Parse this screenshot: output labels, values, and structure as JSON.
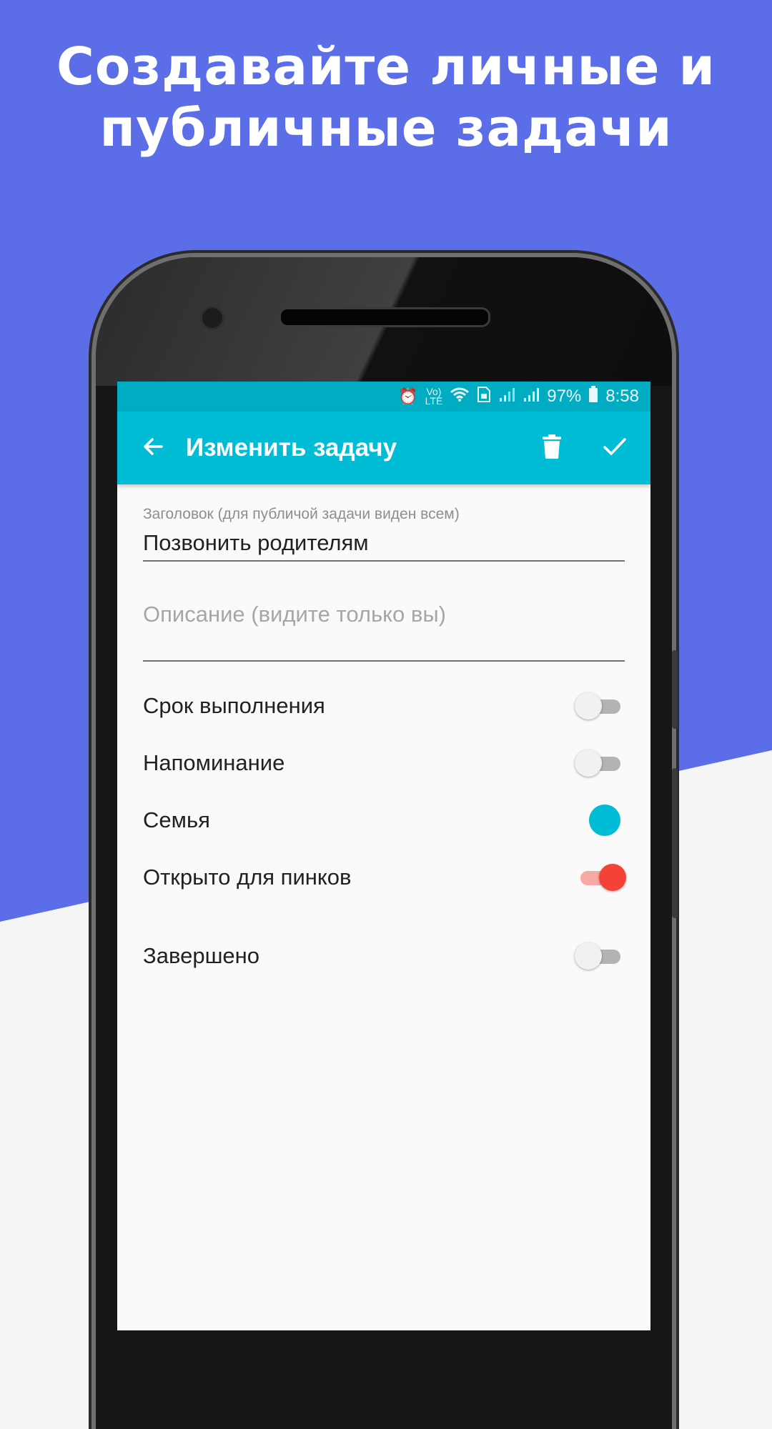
{
  "promo": {
    "line1": "Создавайте личные и",
    "line2": "публичные задачи"
  },
  "status_bar": {
    "icons": [
      "alarm-icon",
      "volte-lte-icon",
      "wifi-icon",
      "sim-icon",
      "signal-icon",
      "signal-icon",
      "battery-icon"
    ],
    "volte_label": "LTE",
    "battery": "97%",
    "time": "8:58"
  },
  "toolbar": {
    "title": "Изменить задачу",
    "back_icon": "arrow-left-icon",
    "delete_icon": "trash-icon",
    "confirm_icon": "check-icon"
  },
  "form": {
    "title_label": "Заголовок (для публичой задачи виден всем)",
    "title_value": "Позвонить родителям",
    "description_placeholder": "Описание (видите только вы)"
  },
  "settings": [
    {
      "label": "Срок выполнения",
      "control": "switch",
      "on": false
    },
    {
      "label": "Напоминание",
      "control": "switch",
      "on": false
    },
    {
      "label": "Семья",
      "control": "dot",
      "on": true
    },
    {
      "label": "Открыто для пинков",
      "control": "switch",
      "on": true
    },
    {
      "label": "Завершено",
      "control": "switch",
      "on": false
    }
  ],
  "colors": {
    "background_accent": "#5b6ee8",
    "toolbar": "#00bcd4",
    "status_bar": "#00acc1",
    "switch_on": "#f44336",
    "family_dot": "#00bcd4"
  }
}
